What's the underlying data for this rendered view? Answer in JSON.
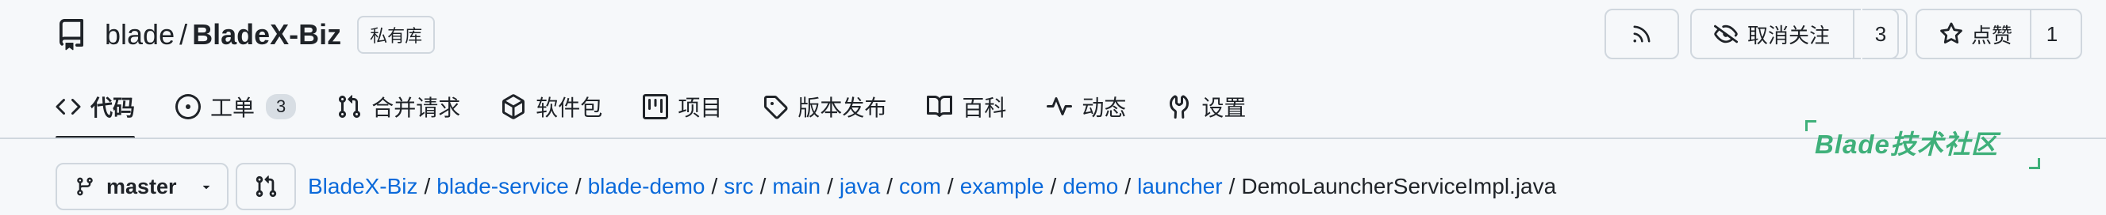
{
  "repo": {
    "owner": "blade",
    "separator": "/",
    "name": "BladeX-Biz",
    "visibility_badge": "私有库"
  },
  "actions": {
    "rss_icon": "rss-icon",
    "watch": {
      "label": "取消关注",
      "icon": "eye-closed-icon",
      "count": "3"
    },
    "star": {
      "label": "点赞",
      "icon": "star-icon",
      "count": "1"
    }
  },
  "tabs": [
    {
      "label": "代码",
      "icon": "code-icon",
      "active": true
    },
    {
      "label": "工单",
      "icon": "issue-icon",
      "counter": "3"
    },
    {
      "label": "合并请求",
      "icon": "pull-request-icon"
    },
    {
      "label": "软件包",
      "icon": "package-icon"
    },
    {
      "label": "项目",
      "icon": "project-icon"
    },
    {
      "label": "版本发布",
      "icon": "tag-icon"
    },
    {
      "label": "百科",
      "icon": "book-icon"
    },
    {
      "label": "动态",
      "icon": "pulse-icon"
    },
    {
      "label": "设置",
      "icon": "tools-icon"
    }
  ],
  "branch": {
    "name": "master",
    "icon": "branch-icon"
  },
  "breadcrumb": {
    "links": [
      "BladeX-Biz",
      "blade-service",
      "blade-demo",
      "src",
      "main",
      "java",
      "com",
      "example",
      "demo",
      "launcher"
    ],
    "separator": "/",
    "current": "DemoLauncherServiceImpl.java"
  },
  "watermark": {
    "text": "Blade技术社区"
  },
  "colors": {
    "link": "#0969da",
    "text": "#1f2328",
    "border": "#d0d7de",
    "background": "#f6f8fa",
    "watermark": "#3fb07a"
  }
}
